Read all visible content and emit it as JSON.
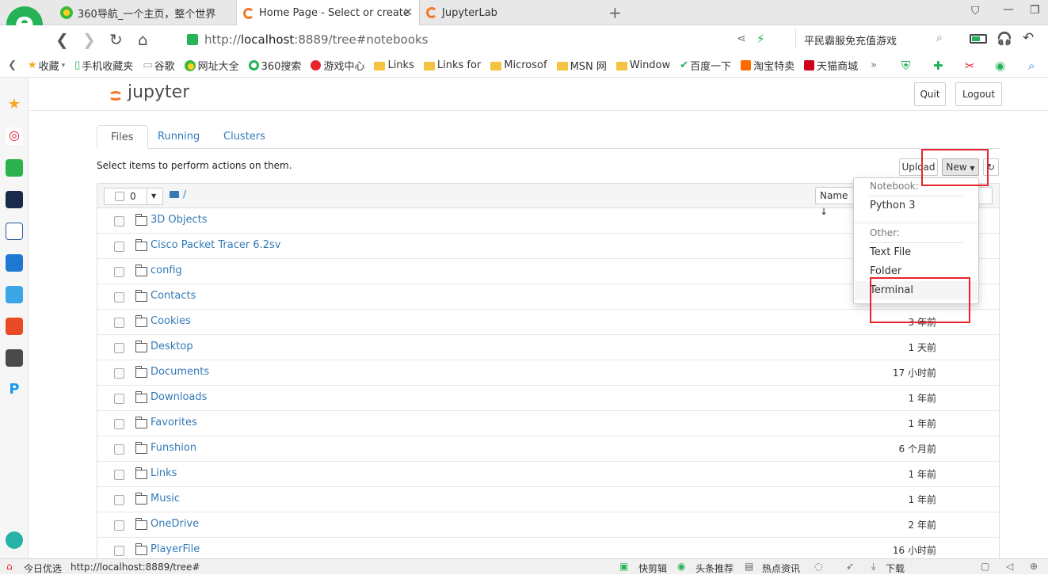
{
  "browser": {
    "tabs": [
      {
        "title": "360导航_一个主页，整个世界"
      },
      {
        "title": "Home Page - Select or create"
      },
      {
        "title": "JupyterLab"
      }
    ],
    "url_prefix": "http://",
    "url_host": "localhost",
    "url_rest": ":8889/tree#notebooks",
    "search_hint": "平民霸服免充值游戏",
    "bookmarks": [
      "收藏",
      "手机收藏夹",
      "谷歌",
      "网址大全",
      "360搜索",
      "游戏中心",
      "Links",
      "Links for",
      "Microsof",
      "MSN 网",
      "Window",
      "百度一下",
      "淘宝特卖",
      "天猫商城"
    ],
    "status_left": "今日优选",
    "status_url": "http://localhost:8889/tree#",
    "status_right": [
      "快剪辑",
      "头条推荐",
      "热点资讯",
      "下载"
    ]
  },
  "jupyter": {
    "logo": "jupyter",
    "quit": "Quit",
    "logout": "Logout",
    "tabs": [
      "Files",
      "Running",
      "Clusters"
    ],
    "hint": "Select items to perform actions on them.",
    "upload": "Upload",
    "new": "New",
    "selected_count": "0",
    "breadcrumb": "/",
    "sort_name": "Name",
    "dropdown": {
      "notebook_header": "Notebook:",
      "python": "Python 3",
      "other_header": "Other:",
      "text_file": "Text File",
      "folder": "Folder",
      "terminal": "Terminal"
    },
    "files": [
      {
        "name": "3D Objects",
        "date": ""
      },
      {
        "name": "Cisco Packet Tracer 6.2sv",
        "date": ""
      },
      {
        "name": "config",
        "date": ""
      },
      {
        "name": "Contacts",
        "date": ""
      },
      {
        "name": "Cookies",
        "date": "3 年前"
      },
      {
        "name": "Desktop",
        "date": "1 天前"
      },
      {
        "name": "Documents",
        "date": "17 小时前"
      },
      {
        "name": "Downloads",
        "date": "1 年前"
      },
      {
        "name": "Favorites",
        "date": "1 年前"
      },
      {
        "name": "Funshion",
        "date": "6 个月前"
      },
      {
        "name": "Links",
        "date": "1 年前"
      },
      {
        "name": "Music",
        "date": "1 年前"
      },
      {
        "name": "OneDrive",
        "date": "2 年前"
      },
      {
        "name": "PlayerFile",
        "date": "16 小时前"
      }
    ]
  }
}
